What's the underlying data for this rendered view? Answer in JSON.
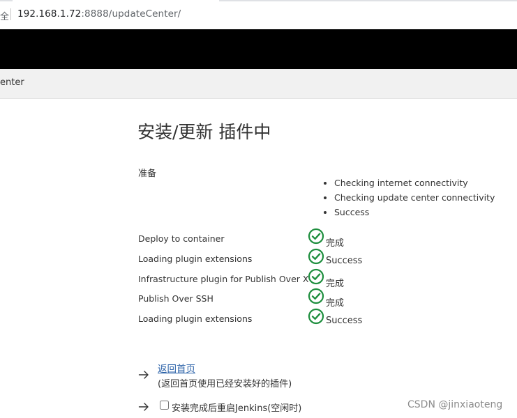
{
  "browser": {
    "security_label": "全",
    "url_host": "192.168.1.72",
    "url_rest": ":8888/updateCenter/"
  },
  "breadcrumb": {
    "current": "enter"
  },
  "page": {
    "title": "安装/更新 插件中",
    "preparation_label": "准备",
    "preparation_checks": [
      "Checking internet connectivity",
      "Checking update center connectivity",
      "Success"
    ],
    "status_rows": [
      {
        "name": "Deploy to container",
        "status": "完成",
        "icon": "check-circle-icon"
      },
      {
        "name": "Loading plugin extensions",
        "status": "Success",
        "icon": "check-circle-icon"
      },
      {
        "name": "Infrastructure plugin for Publish Over X",
        "status": "完成",
        "icon": "check-circle-icon"
      },
      {
        "name": "Publish Over SSH",
        "status": "完成",
        "icon": "check-circle-icon"
      },
      {
        "name": "Loading plugin extensions",
        "status": "Success",
        "icon": "check-circle-icon"
      }
    ],
    "home_link": "返回首页",
    "home_description": "(返回首页使用已经安装好的插件)",
    "restart_label": "安装完成后重启Jenkins(空闲时)"
  },
  "watermark": "CSDN @jinxiaoteng",
  "colors": {
    "success_green": "#1e8e3e",
    "link_blue": "#2b62a8",
    "header_black": "#000000"
  }
}
